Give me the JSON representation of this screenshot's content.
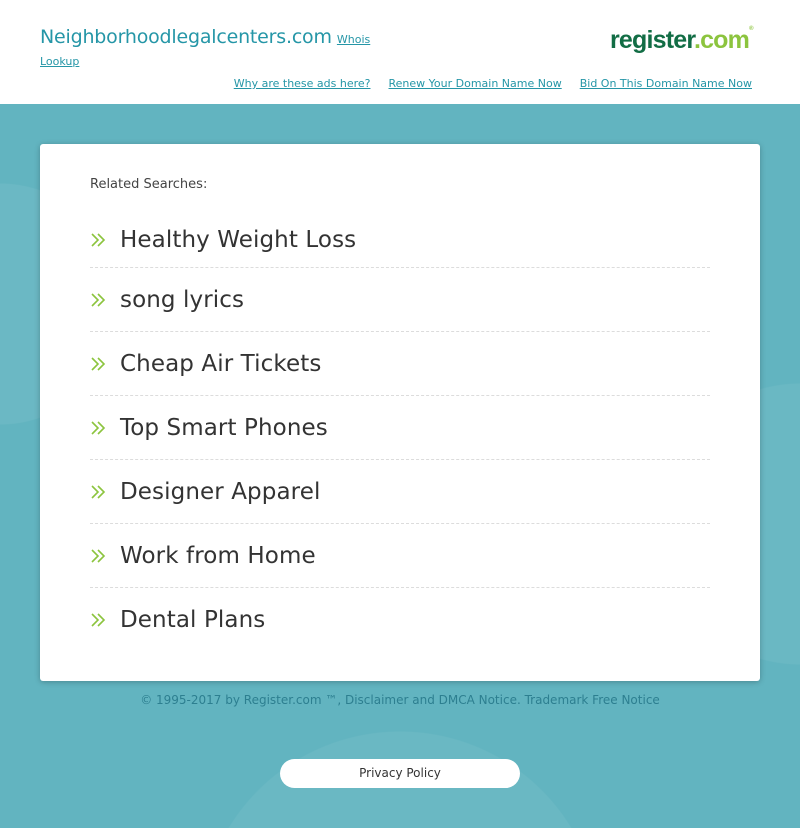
{
  "header": {
    "domain_title": "Neighborhoodlegalcenters.com",
    "whois_link": "Whois Lookup",
    "brand": {
      "name_part1": "register",
      "name_part2": ".com",
      "mark": "®",
      "colors": {
        "primary": "#126d45",
        "secondary": "#8cc43e"
      }
    },
    "links": [
      {
        "label": "Why are these ads here?"
      },
      {
        "label": "Renew Your Domain Name Now"
      },
      {
        "label": "Bid On This Domain Name Now"
      }
    ]
  },
  "main": {
    "related_label": "Related Searches:",
    "searches": [
      {
        "label": "Healthy Weight Loss",
        "icon": "double-chevron-right-icon"
      },
      {
        "label": "song lyrics",
        "icon": "double-chevron-right-icon"
      },
      {
        "label": "Cheap Air Tickets",
        "icon": "double-chevron-right-icon"
      },
      {
        "label": "Top Smart Phones",
        "icon": "double-chevron-right-icon"
      },
      {
        "label": "Designer Apparel",
        "icon": "double-chevron-right-icon"
      },
      {
        "label": "Work from Home",
        "icon": "double-chevron-right-icon"
      },
      {
        "label": "Dental Plans",
        "icon": "double-chevron-right-icon"
      }
    ]
  },
  "footer": {
    "copyright": "© 1995-2017 by Register.com ™, Disclaimer and DMCA Notice. Trademark Free Notice",
    "privacy_button": "Privacy Policy"
  },
  "colors": {
    "accent": "#2596a7",
    "background": "#62b4c0",
    "chevron": "#8cc43e"
  }
}
